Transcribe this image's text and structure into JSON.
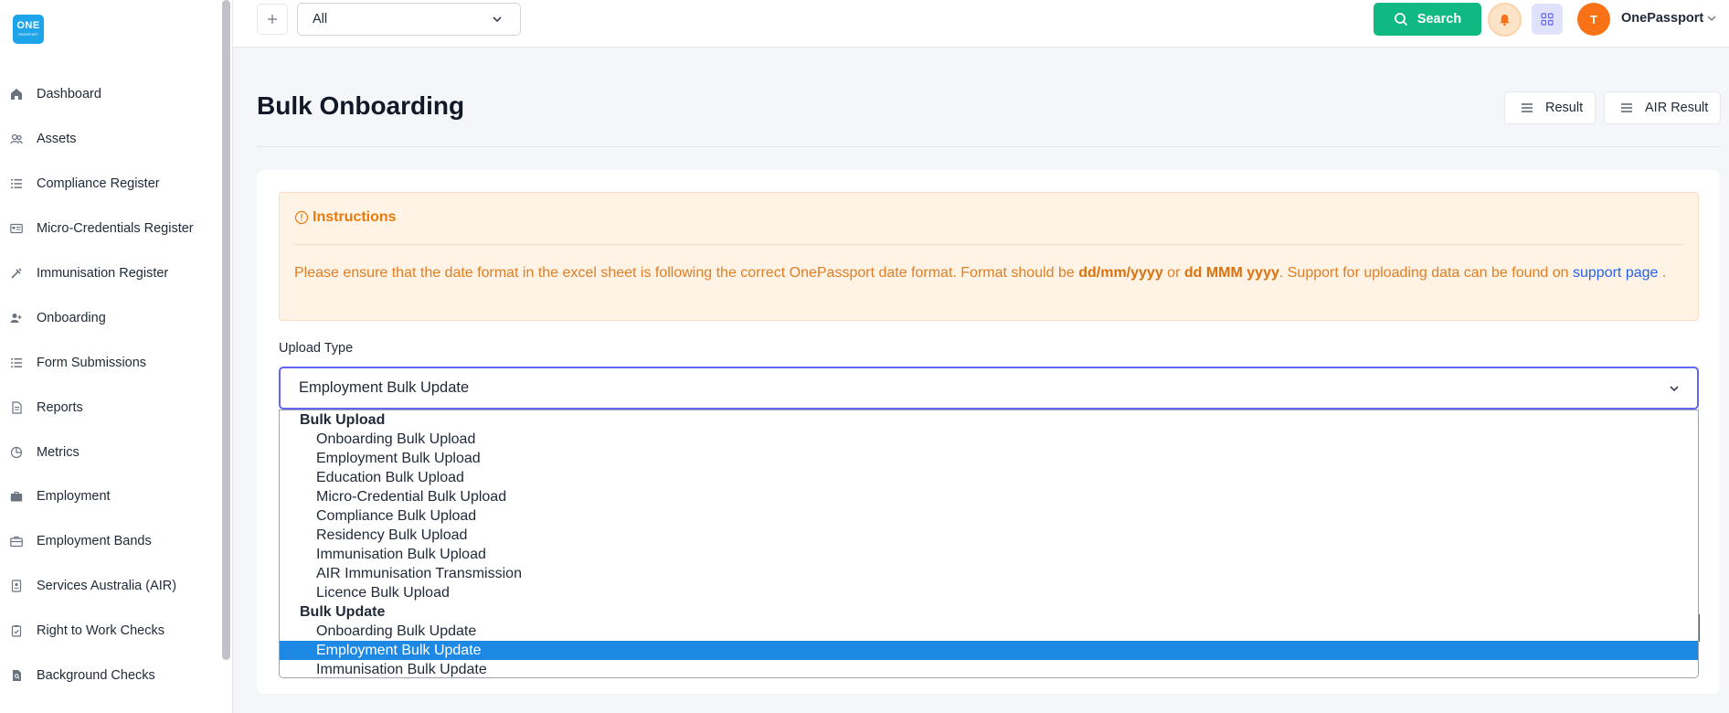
{
  "logo": {
    "line1": "ONE",
    "line2": "PASSPORT"
  },
  "sidebar": {
    "items": [
      {
        "label": "Dashboard",
        "icon": "home-icon"
      },
      {
        "label": "Assets",
        "icon": "users-icon"
      },
      {
        "label": "Compliance Register",
        "icon": "list-icon"
      },
      {
        "label": "Micro-Credentials Register",
        "icon": "id-card-icon"
      },
      {
        "label": "Immunisation Register",
        "icon": "syringe-icon"
      },
      {
        "label": "Onboarding",
        "icon": "user-plus-icon"
      },
      {
        "label": "Form Submissions",
        "icon": "list-icon"
      },
      {
        "label": "Reports",
        "icon": "document-icon"
      },
      {
        "label": "Metrics",
        "icon": "pie-chart-icon"
      },
      {
        "label": "Employment",
        "icon": "briefcase-icon"
      },
      {
        "label": "Employment Bands",
        "icon": "briefcase-outline-icon"
      },
      {
        "label": "Services Australia (AIR)",
        "icon": "badge-icon"
      },
      {
        "label": "Right to Work Checks",
        "icon": "clipboard-check-icon"
      },
      {
        "label": "Background Checks",
        "icon": "file-search-icon"
      }
    ]
  },
  "topbar": {
    "scope_value": "All",
    "search_label": "Search",
    "avatar_initial": "T",
    "user_name": "OnePassport"
  },
  "page": {
    "title": "Bulk Onboarding",
    "result_label": "Result",
    "air_result_label": "AIR Result"
  },
  "instructions": {
    "title": "Instructions",
    "text_1": "Please ensure that the date format in the excel sheet is following the correct OnePassport date format. Format should be ",
    "format_1": "dd/mm/yyyy",
    "text_or": " or ",
    "format_2": "dd MMM yyyy",
    "text_2": ". Support for uploading data can be found on ",
    "link": "support page",
    "text_end": " ."
  },
  "upload": {
    "label": "Upload Type",
    "selected": "Employment Bulk Update",
    "groups": [
      {
        "label": "Bulk Upload",
        "options": [
          "Onboarding Bulk Upload",
          "Employment Bulk Upload",
          "Education Bulk Upload",
          "Micro-Credential Bulk Upload",
          "Compliance Bulk Upload",
          "Residency Bulk Upload",
          "Immunisation Bulk Upload",
          "AIR Immunisation Transmission",
          "Licence Bulk Upload"
        ]
      },
      {
        "label": "Bulk Update",
        "options": [
          "Onboarding Bulk Update",
          "Employment Bulk Update",
          "Immunisation Bulk Update"
        ]
      }
    ]
  },
  "colors": {
    "accent": "#10b981",
    "brand": "#1ea4e9",
    "warning_text": "#ea7a0c",
    "selected_option": "#1e88e5"
  }
}
